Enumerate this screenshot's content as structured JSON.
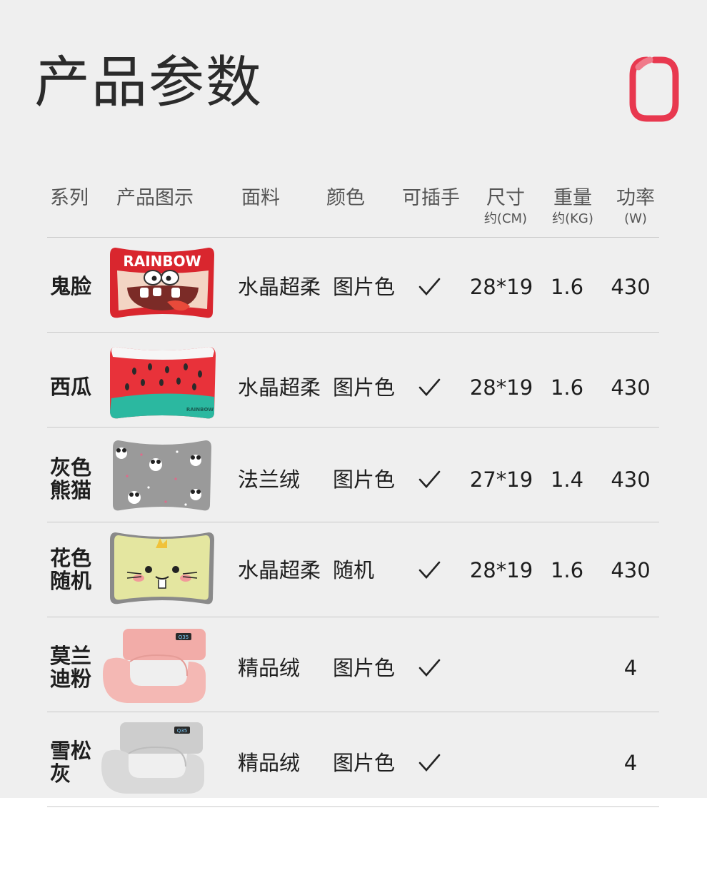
{
  "page_title": "产品参数",
  "header": {
    "series": "系列",
    "image": "产品图示",
    "fabric": "面料",
    "color": "颜色",
    "hand_insert": "可插手",
    "size": "尺寸",
    "size_unit": "约(CM)",
    "weight": "重量",
    "weight_unit": "约(KG)",
    "power": "功率",
    "power_unit": "(W)"
  },
  "rows": [
    {
      "series_l1": "鬼脸",
      "series_l2": "",
      "image_label": "RAINBOW",
      "fabric": "水晶超柔",
      "color": "图片色",
      "hand_insert": "✓",
      "size": "28*19",
      "weight": "1.6",
      "power": "430"
    },
    {
      "series_l1": "西瓜",
      "series_l2": "",
      "image_label": "RAINBOW",
      "fabric": "水晶超柔",
      "color": "图片色",
      "hand_insert": "✓",
      "size": "28*19",
      "weight": "1.6",
      "power": "430"
    },
    {
      "series_l1": "灰色",
      "series_l2": "熊猫",
      "fabric": "法兰绒",
      "color": "图片色",
      "hand_insert": "✓",
      "size": "27*19",
      "weight": "1.4",
      "power": "430"
    },
    {
      "series_l1": "花色",
      "series_l2": "随机",
      "fabric": "水晶超柔",
      "color": "随机",
      "hand_insert": "✓",
      "size": "28*19",
      "weight": "1.6",
      "power": "430"
    },
    {
      "series_l1": "莫兰",
      "series_l2": "迪粉",
      "image_label": "Q35",
      "fabric": "精品绒",
      "color": "图片色",
      "hand_insert": "✓",
      "size": "",
      "weight": "",
      "power": "4"
    },
    {
      "series_l1": "雪松",
      "series_l2": "灰",
      "image_label": "Q35",
      "fabric": "精品绒",
      "color": "图片色",
      "hand_insert": "✓",
      "size": "",
      "weight": "",
      "power": "4"
    }
  ],
  "colors": {
    "panel": "#efefef",
    "accent": "#e8384f",
    "ghost_red": "#d9262e",
    "watermelon_red": "#e8323a",
    "watermelon_green": "#2bb8a0",
    "panda_grey": "#9a9a9a",
    "yellow": "#e4e6a0",
    "pink": "#f4b8b4",
    "light_grey": "#d3d3d3"
  },
  "icons": [
    "logo-icon",
    "checkmark-icon"
  ]
}
